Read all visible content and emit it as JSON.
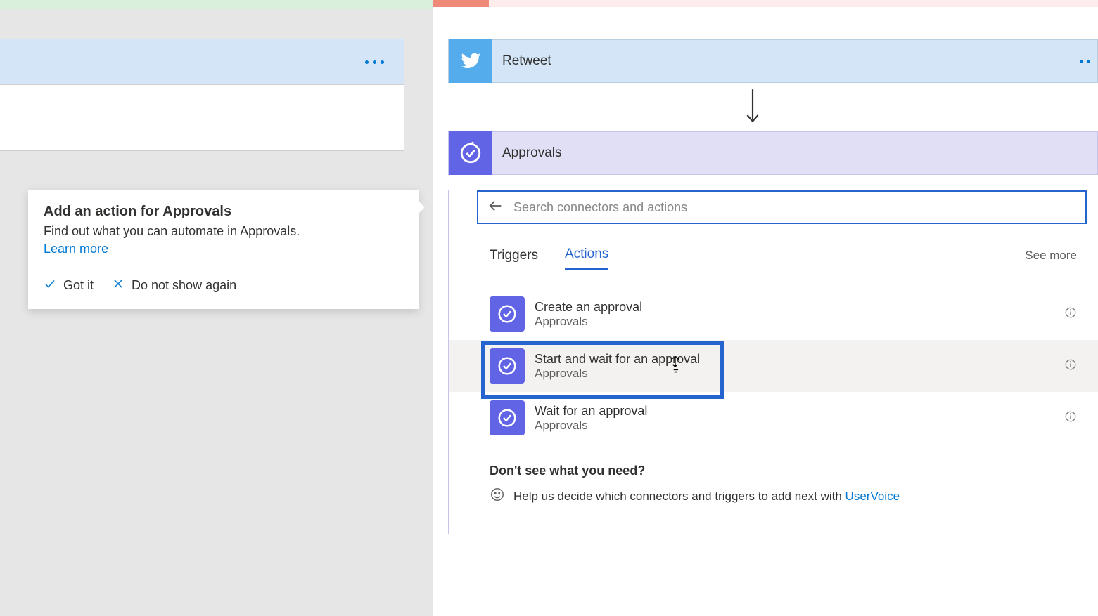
{
  "tooltip": {
    "title": "Add an action for Approvals",
    "body": "Find out what you can automate in Approvals.",
    "learn_more": "Learn more",
    "got_it": "Got it",
    "do_not_show": "Do not show again"
  },
  "steps": {
    "retweet": "Retweet",
    "approvals": "Approvals"
  },
  "picker": {
    "search_placeholder": "Search connectors and actions",
    "tab_triggers": "Triggers",
    "tab_actions": "Actions",
    "see_more": "See more",
    "items": [
      {
        "title": "Create an approval",
        "sub": "Approvals"
      },
      {
        "title": "Start and wait for an approval",
        "sub": "Approvals"
      },
      {
        "title": "Wait for an approval",
        "sub": "Approvals"
      }
    ],
    "footer_q": "Don't see what you need?",
    "footer_line": "Help us decide which connectors and triggers to add next with ",
    "uservoice": "UserVoice"
  }
}
